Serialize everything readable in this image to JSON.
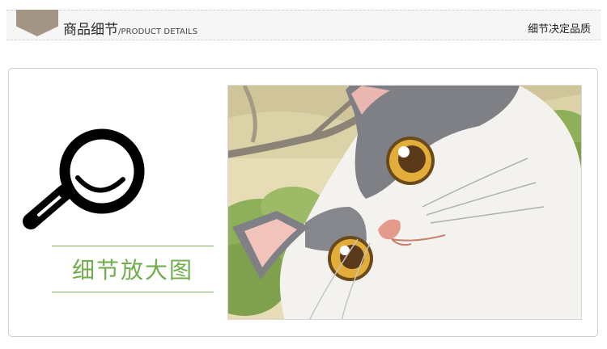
{
  "header": {
    "title": "商品细节",
    "subtitle": "/PRODUCT DETAILS",
    "slogan": "细节决定品质"
  },
  "section": {
    "label": "细节放大图"
  },
  "icons": {
    "badge": "chevron-banner-icon",
    "magnifier": "magnifying-glass-icon"
  },
  "image": {
    "subject": "cartoon-cat-closeup"
  },
  "colors": {
    "badge": "#a29585",
    "accent_green": "#6fae4a",
    "rule_green": "#7fae5b"
  }
}
